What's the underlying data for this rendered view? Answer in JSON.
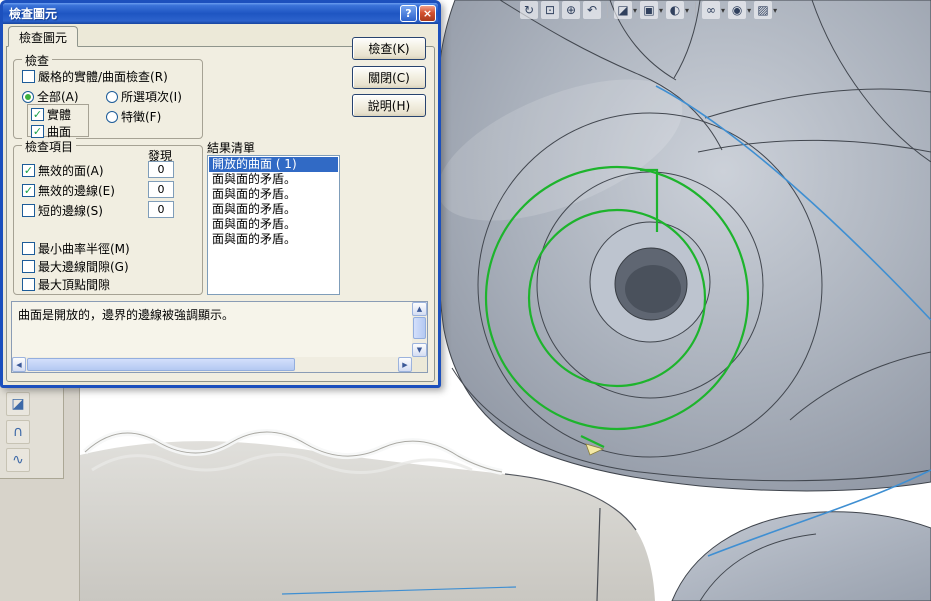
{
  "glyphs": {
    "check": "✓",
    "dropdown": "▾",
    "up_arrow": "▲",
    "down_arrow": "▼",
    "left_arrow": "◀",
    "right_arrow": "▶",
    "help": "?",
    "close": "×"
  },
  "colors": {
    "highlight_green": "#1db42c",
    "edge_blue": "#3f8fd2",
    "selection_blue": "#316ac5",
    "titlebar_blue": "#1e55c2",
    "dialog_bg": "#ece9d8"
  },
  "window": {
    "title": "檢查圖元"
  },
  "dialog": {
    "tab_label": "檢查圖元",
    "check_group": {
      "legend": "檢查",
      "strict_label": "嚴格的實體/曲面檢查(R)",
      "radio_all": "全部(A)",
      "radio_selected": "所選項次(I)",
      "radio_feature": "特徵(F)",
      "solid_label": "實體",
      "surface_label": "曲面"
    },
    "items_group": {
      "legend": "檢查項目",
      "found_header": "發現",
      "rows": [
        {
          "label": "無效的面(A)",
          "count": "0"
        },
        {
          "label": "無效的邊線(E)",
          "count": "0"
        },
        {
          "label": "短的邊線(S)",
          "count": "0"
        }
      ],
      "extra_rows": [
        {
          "label": "最小曲率半徑(M)"
        },
        {
          "label": "最大邊線間隙(G)"
        },
        {
          "label": "最大頂點間隙"
        }
      ]
    },
    "result_list": {
      "label": "結果清單",
      "items": [
        "開放的曲面 ( 1)",
        "面與面的矛盾。",
        "面與面的矛盾。",
        "面與面的矛盾。",
        "面與面的矛盾。",
        "面與面的矛盾。"
      ]
    },
    "message": "曲面是開放的，邊界的邊線被強調顯示。",
    "buttons": {
      "check": "檢查(K)",
      "close": "關閉(C)",
      "help": "說明(H)"
    }
  },
  "view_toolbar": {
    "items": [
      {
        "name": "rotate-view",
        "glyph": "↻"
      },
      {
        "name": "zoom-to-fit",
        "glyph": "⊡"
      },
      {
        "name": "zoom-to-area",
        "glyph": "⊕"
      },
      {
        "name": "previous-view",
        "glyph": "↶"
      },
      {
        "name": "section-view",
        "glyph": "◪"
      },
      {
        "name": "view-orientation",
        "glyph": "▣"
      },
      {
        "name": "display-style",
        "glyph": "◐"
      },
      {
        "name": "hide-show-items",
        "glyph": "∞"
      },
      {
        "name": "edit-appearance",
        "glyph": "◉"
      },
      {
        "name": "apply-scene",
        "glyph": "▨"
      }
    ]
  },
  "side_toolbar": {
    "items": [
      {
        "name": "surface-tool-1",
        "glyph": "◪"
      },
      {
        "name": "surface-tool-2",
        "glyph": "∩"
      },
      {
        "name": "surface-tool-3",
        "glyph": "∿"
      }
    ]
  }
}
